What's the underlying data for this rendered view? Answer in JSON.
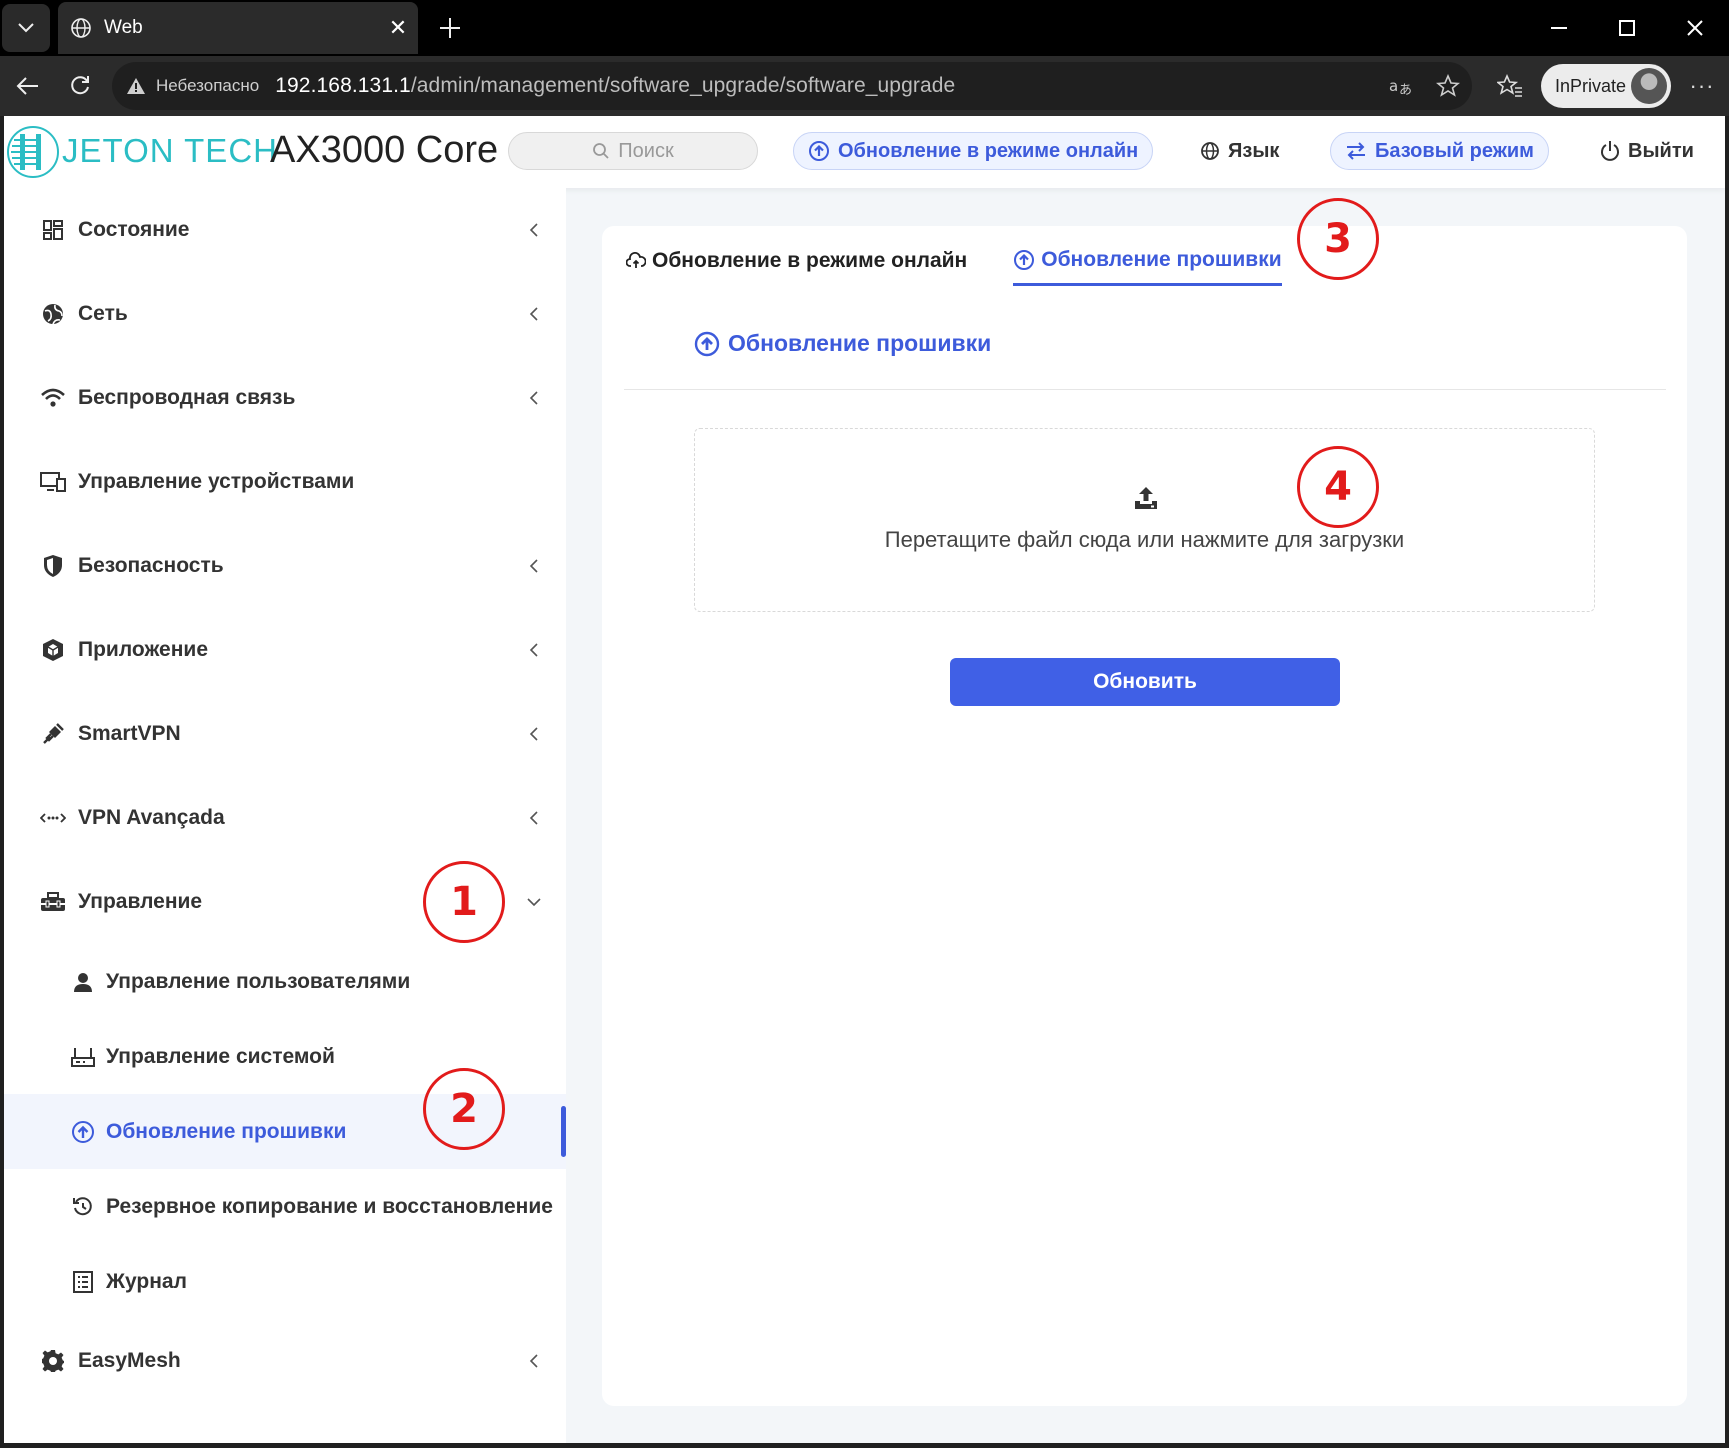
{
  "browser": {
    "tab_title": "Web",
    "security_warning": "Небезопасно",
    "url_host": "192.168.131.1",
    "url_path": "/admin/management/software_upgrade/software_upgrade",
    "inprivate_label": "InPrivate"
  },
  "header": {
    "brand": "JETON TECH",
    "model": "AX3000 Core",
    "search_placeholder": "Поиск",
    "online_update": "Обновление в режиме онлайн",
    "language": "Язык",
    "basic_mode": "Базовый режим",
    "logout": "Выйти"
  },
  "sidebar": {
    "items": [
      {
        "label": "Состояние",
        "icon": "dashboard-icon"
      },
      {
        "label": "Сеть",
        "icon": "globe-network-icon"
      },
      {
        "label": "Беспроводная связь",
        "icon": "wifi-icon"
      },
      {
        "label": "Управление устройствами",
        "icon": "devices-icon"
      },
      {
        "label": "Безопасность",
        "icon": "shield-icon"
      },
      {
        "label": "Приложение",
        "icon": "cube-icon"
      },
      {
        "label": "SmartVPN",
        "icon": "plug-icon"
      },
      {
        "label": "VPN Avançada",
        "icon": "dots-arrows-icon"
      },
      {
        "label": "Управление",
        "icon": "toolbox-icon"
      }
    ],
    "subitems": [
      {
        "label": "Управление пользователями",
        "icon": "user-icon"
      },
      {
        "label": "Управление системой",
        "icon": "router-icon"
      },
      {
        "label": "Обновление прошивки",
        "icon": "upload-circle-icon"
      },
      {
        "label": "Резервное копирование и восстановление",
        "icon": "restore-icon"
      },
      {
        "label": "Журнал",
        "icon": "log-icon"
      }
    ],
    "after_items": [
      {
        "label": "EasyMesh",
        "icon": "gear-icon"
      }
    ]
  },
  "content": {
    "tabs": [
      {
        "label": "Обновление в режиме онлайн"
      },
      {
        "label": "Обновление прошивки"
      }
    ],
    "section_title": "Обновление прошивки",
    "dropzone_text": "Перетащите файл сюда или нажмите для загрузки",
    "update_button": "Обновить"
  },
  "annotations": [
    "1",
    "2",
    "3",
    "4"
  ],
  "colors": {
    "accent": "#3d5bdb",
    "brand": "#2bbdc4",
    "annotation": "#e21b1b"
  }
}
